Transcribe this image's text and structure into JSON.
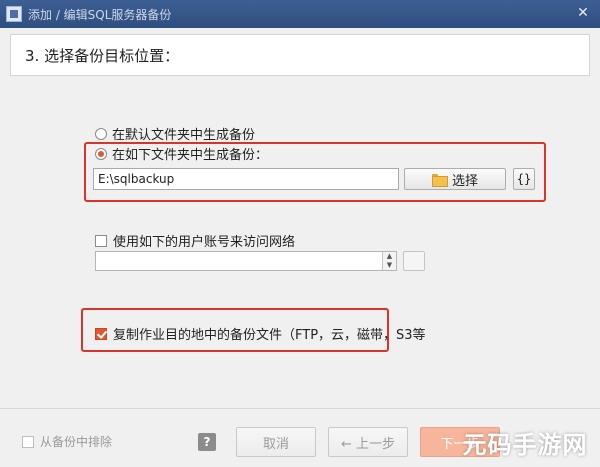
{
  "window": {
    "title": "添加 / 编辑SQL服务器备份",
    "close_glyph": "✕"
  },
  "header": {
    "step_title": "3. 选择备份目标位置："
  },
  "destination": {
    "default_option_label": "在默认文件夹中生成备份",
    "custom_option_label": "在如下文件夹中生成备份：",
    "selected": "custom",
    "path_value": "E:\\sqlbackup",
    "select_button_label": "选择",
    "macro_button_label": "{}"
  },
  "network": {
    "use_account_label": "使用如下的用户账号来访问网络",
    "checked": false,
    "account_value": ""
  },
  "copy": {
    "label": "复制作业目的地中的备份文件（FTP，云，磁带，S3等",
    "checked": true
  },
  "footer": {
    "exclude_label": "从备份中排除",
    "help_label": "?",
    "cancel_label": "取消",
    "prev_label": "← 上一步",
    "next_label": "下一步"
  },
  "watermark": {
    "text": "元码手游网"
  },
  "colors": {
    "accent": "#e0582e",
    "highlight_box": "#d9332b",
    "titlebar": "#2f4e80"
  },
  "icons": {
    "folder": "folder-icon",
    "close": "close-icon",
    "help": "help-icon"
  }
}
